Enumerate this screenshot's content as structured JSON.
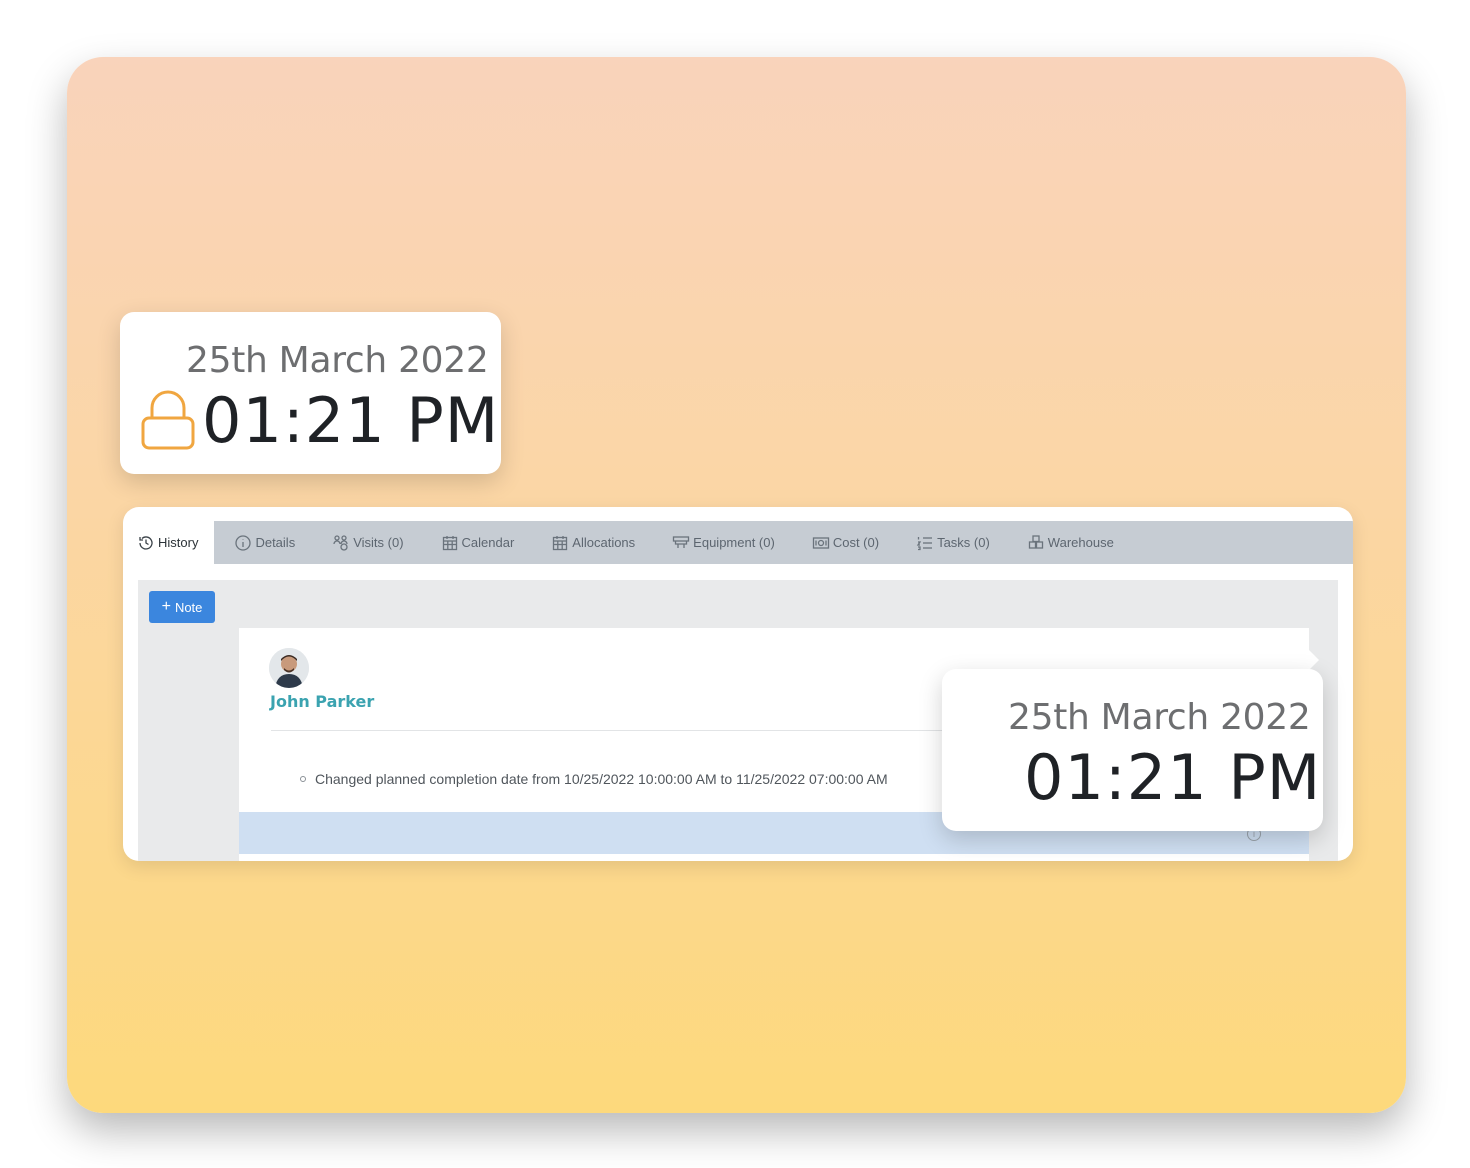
{
  "time_card_top": {
    "date": "25th March 2022",
    "time": "01:21 PM",
    "lock_color": "#f0a640"
  },
  "tabs": [
    {
      "label": "History",
      "icon": "history-icon",
      "active": true
    },
    {
      "label": "Details",
      "icon": "info-icon",
      "active": false
    },
    {
      "label": "Visits (0)",
      "icon": "visits-icon",
      "active": false
    },
    {
      "label": "Calendar",
      "icon": "calendar-icon",
      "active": false
    },
    {
      "label": "Allocations",
      "icon": "allocations-icon",
      "active": false
    },
    {
      "label": "Equipment (0)",
      "icon": "equipment-icon",
      "active": false
    },
    {
      "label": "Cost (0)",
      "icon": "cost-icon",
      "active": false
    },
    {
      "label": "Tasks (0)",
      "icon": "tasks-icon",
      "active": false
    },
    {
      "label": "Warehouse",
      "icon": "warehouse-icon",
      "active": false
    }
  ],
  "note_button": {
    "label": "Note"
  },
  "history_entry": {
    "author": "John Parker",
    "change": "Changed planned completion date from 10/25/2022 10:00:00 AM to 11/25/2022 07:00:00 AM"
  },
  "time_card_bottom": {
    "date": "25th March 2022",
    "time": "01:21 PM"
  },
  "colors": {
    "accent_blue": "#3b86de",
    "author_teal": "#3ba3b0",
    "tabbar_bg": "#c6ccd3"
  }
}
